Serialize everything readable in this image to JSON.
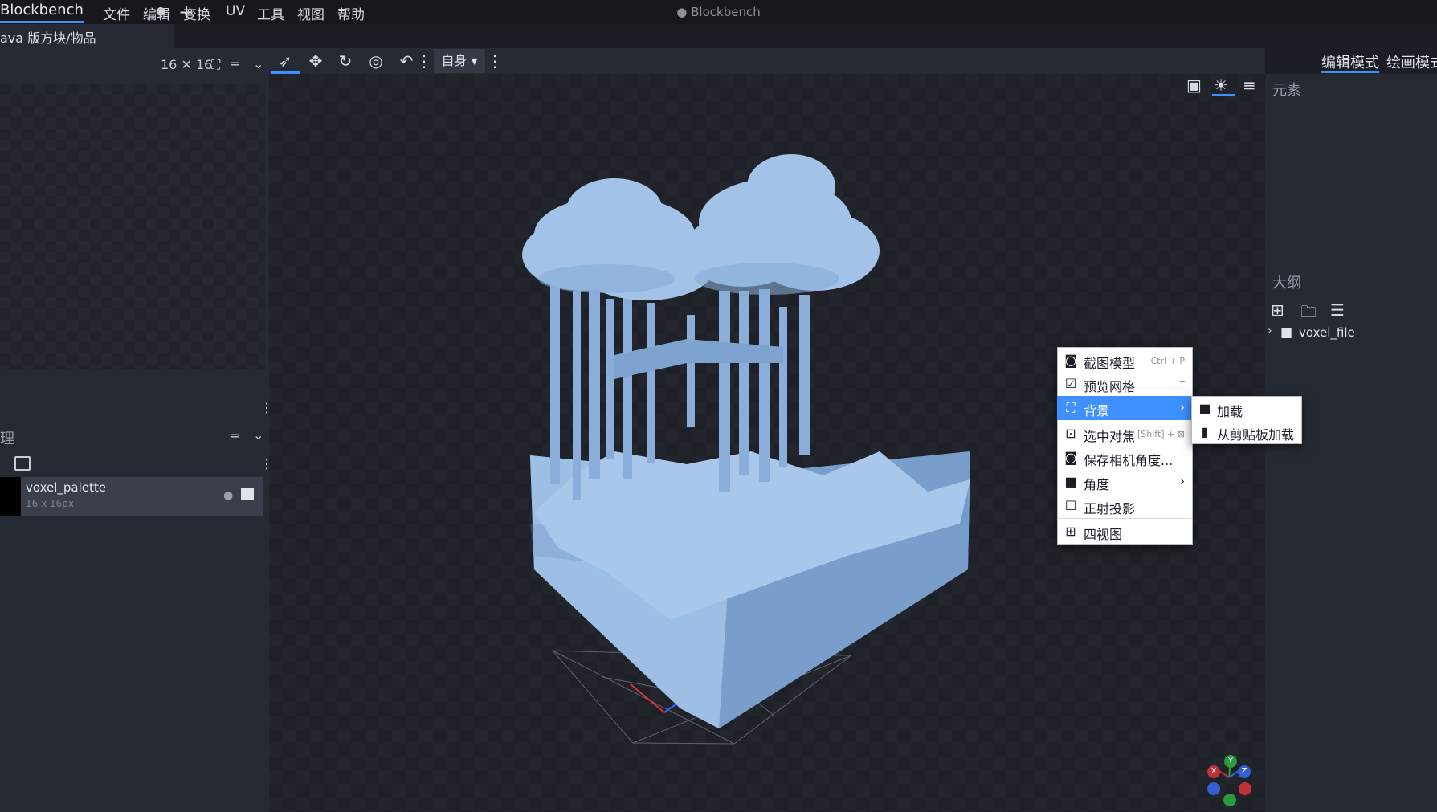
{
  "menubar": {
    "app_name": "Blockbench",
    "items": [
      "文件",
      "编辑",
      "变换",
      "UV",
      "工具",
      "视图",
      "帮助"
    ],
    "window_title": "● Blockbench"
  },
  "tabs": {
    "active_label": "ava 版方块/物品",
    "unsaved_dot": "●",
    "add": "+"
  },
  "uv_panel": {
    "size_label": "16 ✕ 16"
  },
  "textures_panel": {
    "title": "理",
    "texture": {
      "name": "voxel_palette",
      "size": "16 x 16px"
    }
  },
  "toolbar": {
    "space_select": "自身 ▾"
  },
  "mode_tabs": {
    "edit": "编辑模式",
    "paint": "绘画模式"
  },
  "right_panel": {
    "elements_title": "元素",
    "outliner_title": "大纲",
    "outliner_item": "voxel_file"
  },
  "context_menu": {
    "items": [
      {
        "label": "截图模型",
        "shortcut": "Ctrl + P",
        "icon": "camera-icon"
      },
      {
        "label": "预览网格",
        "shortcut": "T",
        "icon": "checkbox-checked-icon"
      },
      {
        "label": "背景",
        "icon": "background-icon",
        "has_submenu": true
      },
      {
        "label": "选中对焦",
        "shortcut": "[Shift] + ⊠",
        "icon": "focus-icon"
      },
      {
        "label": "保存相机角度...",
        "icon": "add-camera-icon"
      },
      {
        "label": "角度",
        "icon": "video-camera-icon",
        "has_submenu": true
      },
      {
        "label": "正射投影",
        "icon": "checkbox-unchecked-icon"
      },
      {
        "label": "四视图",
        "icon": "grid-icon"
      }
    ],
    "highlighted": "背景"
  },
  "submenu": {
    "items": [
      {
        "label": "加载",
        "icon": "folder-icon"
      },
      {
        "label": "从剪贴板加载",
        "icon": "clipboard-icon"
      }
    ]
  },
  "gizmo": {
    "x": "X",
    "y": "Y",
    "z": "Z"
  },
  "colors": {
    "accent": "#3e90ff",
    "model": "#8fb3de",
    "background": "#1b1e25",
    "panel": "#262a33"
  }
}
